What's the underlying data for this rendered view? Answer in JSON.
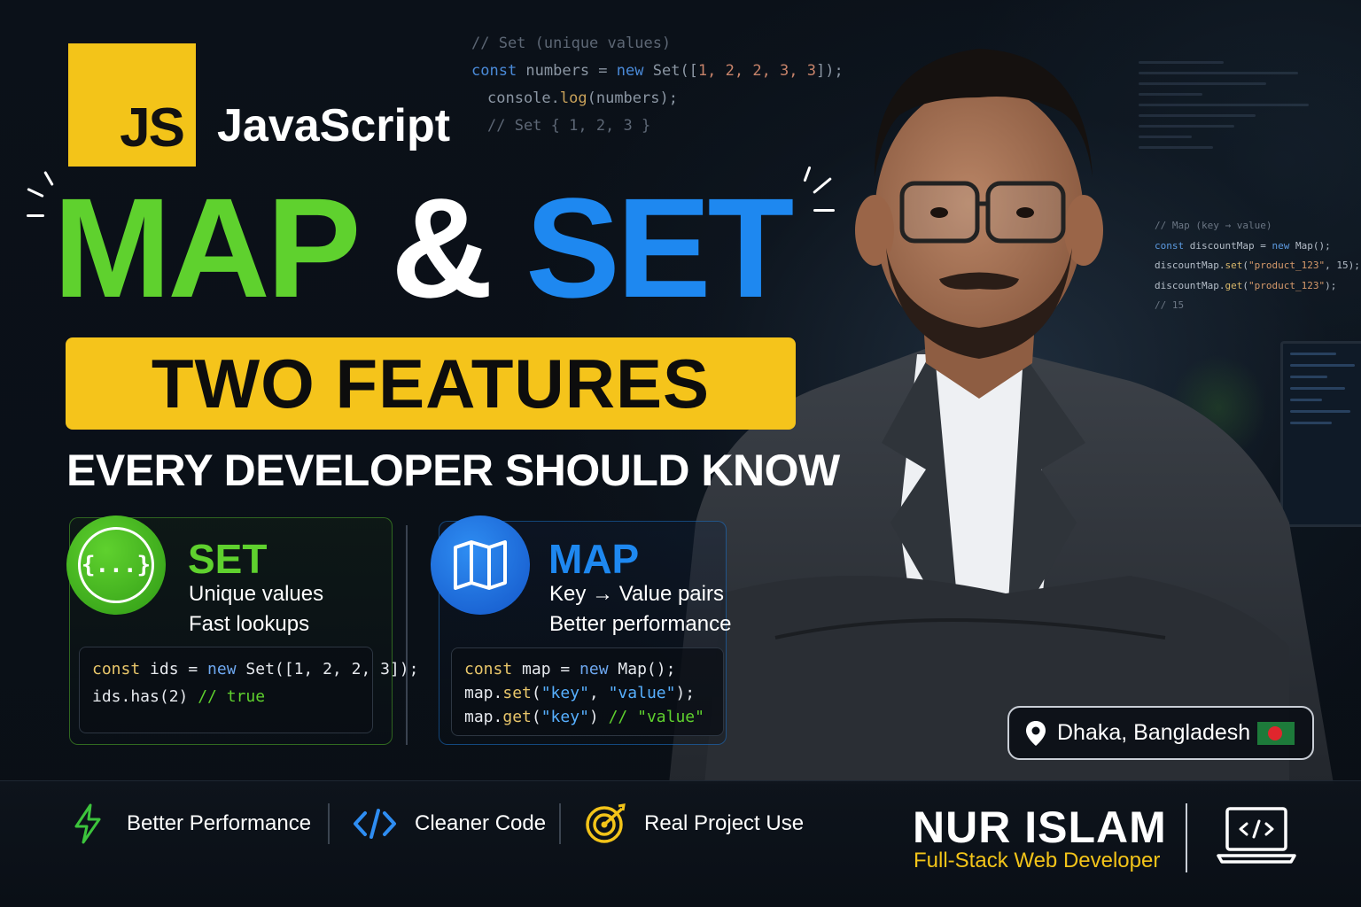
{
  "background_code": {
    "comment": "// Set (unique values)",
    "line1_kw": "const",
    "line1_rest": " numbers = ",
    "line1_new": "new",
    "line1_set": " Set([",
    "line1_nums": "1, 2, 2, 3, 3",
    "line1_end": "]);",
    "line2_a": "console.",
    "line2_fn": "log",
    "line2_b": "(numbers);",
    "line3": "// Set { 1, 2, 3 }"
  },
  "side_code": {
    "comment": "// Map  (key → value)",
    "l1_kw": "const",
    "l1_rest": " discountMap = ",
    "l1_new": "new",
    "l1_end": " Map();",
    "l2_a": "discountMap.",
    "l2_fn": "set",
    "l2_b": "(",
    "l2_str": "\"product_123\"",
    "l2_c": ", 15);",
    "l3_a": "discountMap.",
    "l3_fn": "get",
    "l3_b": "(",
    "l3_str": "\"product_123\"",
    "l3_c": ");",
    "l4": "// 15"
  },
  "logo": {
    "badge": "JS",
    "title": "JavaScript"
  },
  "hero": {
    "map": "MAP",
    "amp": "&",
    "set": "SET"
  },
  "banner": "TWO FEATURES",
  "subline": "EVERY DEVELOPER SHOULD KNOW",
  "set_card": {
    "icon_text": "{...}",
    "title": "SET",
    "line1": "Unique values",
    "line2": "Fast lookups",
    "code1_kw": "const",
    "code1_a": " ids = ",
    "code1_new": "new",
    "code1_b": " Set([1, 2, 2, 3]);",
    "code2_a": "ids.has(2) ",
    "code2_cm": "// true"
  },
  "map_card": {
    "title": "MAP",
    "line1": "Key → Value pairs",
    "line2": "Better performance",
    "code1_kw": "const",
    "code1_a": " map = ",
    "code1_new": "new",
    "code1_b": " Map();",
    "code2_a": "map.",
    "code2_fn": "set",
    "code2_b": "(",
    "code2_s1": "\"key\"",
    "code2_c": ", ",
    "code2_s2": "\"value\"",
    "code2_d": ");",
    "code3_a": "map.",
    "code3_fn": "get",
    "code3_b": "(",
    "code3_s1": "\"key\"",
    "code3_c": ") ",
    "code3_cm": "// \"value\""
  },
  "location": {
    "text": "Dhaka, Bangladesh",
    "icon": "map-pin-icon",
    "flag": "bangladesh-flag"
  },
  "features": [
    {
      "icon": "lightning-icon",
      "label": "Better Performance"
    },
    {
      "icon": "code-brackets-icon",
      "label": "Cleaner Code"
    },
    {
      "icon": "target-icon",
      "label": "Real Project Use"
    }
  ],
  "author": {
    "name": "NUR ISLAM",
    "role": "Full-Stack Web Developer",
    "icon": "laptop-code-icon"
  },
  "colors": {
    "js_yellow": "#f3c419",
    "map_green": "#5fd12e",
    "set_blue": "#1e88f0",
    "background": "#0a0f16"
  }
}
